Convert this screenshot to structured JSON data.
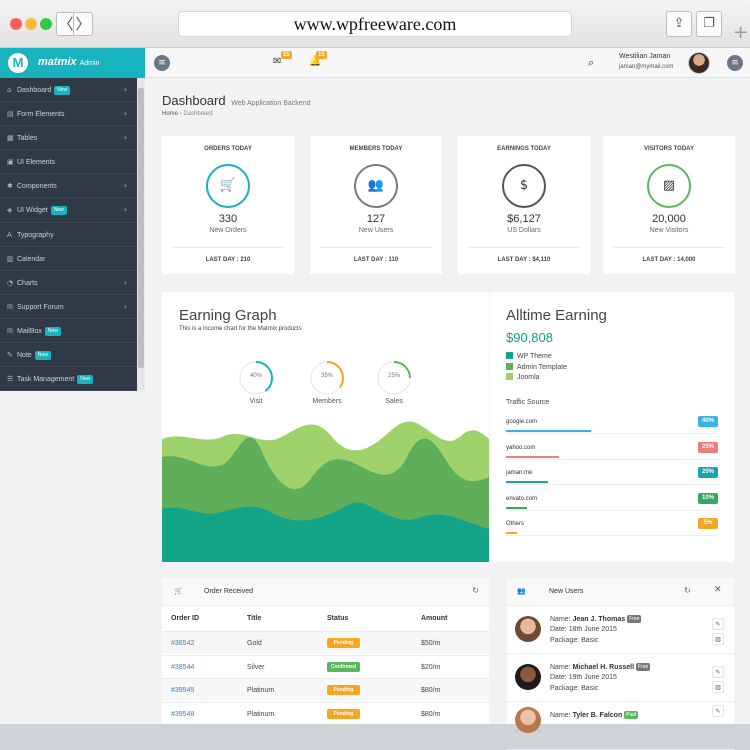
{
  "browser": {
    "url": "www.wpfreeware.com",
    "back_glyph": "〈",
    "forward_glyph": "〉",
    "share_icon": "share-icon",
    "tabs_icon": "tabs-icon",
    "colors": {
      "close": "#fc605c",
      "minimize": "#fdbc40",
      "zoom": "#34c84a"
    }
  },
  "brand": {
    "logo_letter": "M",
    "name": "matmix",
    "suffix": "Admin",
    "color": "#19b3bf"
  },
  "topbar": {
    "messages_count": "15",
    "notifications_count": "15",
    "user_name": "Westilian Jaman",
    "user_email": "jaman@mymail.com"
  },
  "sidebar": {
    "new_label": "New",
    "items": [
      {
        "label": "Dashboard",
        "icon": "⌂",
        "badge": true,
        "chevron": true
      },
      {
        "label": "Form Elements",
        "icon": "▤",
        "badge": false,
        "chevron": true
      },
      {
        "label": "Tables",
        "icon": "▦",
        "badge": false,
        "chevron": true
      },
      {
        "label": "UI Elements",
        "icon": "▣",
        "badge": false,
        "chevron": false
      },
      {
        "label": "Components",
        "icon": "✱",
        "badge": false,
        "chevron": true
      },
      {
        "label": "UI Widget",
        "icon": "◈",
        "badge": true,
        "chevron": true
      },
      {
        "label": "Typography",
        "icon": "A",
        "badge": false,
        "chevron": false
      },
      {
        "label": "Calendar",
        "icon": "▥",
        "badge": false,
        "chevron": false
      },
      {
        "label": "Charts",
        "icon": "◔",
        "badge": false,
        "chevron": true
      },
      {
        "label": "Support Forum",
        "icon": "✉",
        "badge": false,
        "chevron": true
      },
      {
        "label": "MailBox",
        "icon": "✉",
        "badge": true,
        "chevron": false
      },
      {
        "label": "Note",
        "icon": "✎",
        "badge": true,
        "chevron": false
      },
      {
        "label": "Task Management",
        "icon": "☰",
        "badge": true,
        "chevron": false
      }
    ]
  },
  "page": {
    "title": "Dashboard",
    "subtitle": "Web Application Backend",
    "breadcrumb_home": "Home",
    "breadcrumb_sep": "›",
    "breadcrumb_current": "Dashboard"
  },
  "stats": [
    {
      "title": "ORDERS TODAY",
      "value": "330",
      "label": "New Orders",
      "last": "LAST DAY : 210",
      "icon": "🛒",
      "color": "#19b3bf"
    },
    {
      "title": "MEMBERS TODAY",
      "value": "127",
      "label": "New Users",
      "last": "LAST DAY : 110",
      "icon": "👥",
      "color": "#7a7a7a"
    },
    {
      "title": "EARNINGS TODAY",
      "value": "$6,127",
      "label": "US Dollars",
      "last": "LAST DAY : $4,110",
      "icon": "$",
      "color": "#555555"
    },
    {
      "title": "VISITORS TODAY",
      "value": "20,000",
      "label": "New Visitors",
      "last": "LAST DAY : 14,000",
      "icon": "▨",
      "color": "#5cb85c"
    }
  ],
  "earning_graph": {
    "title": "Earning Graph",
    "subtitle": "This is a income chart for the Matmix products",
    "gauges": [
      {
        "label": "Visit",
        "value": "40%",
        "fraction": 0.4,
        "color": "#19b3bf"
      },
      {
        "label": "Members",
        "value": "35%",
        "fraction": 0.35,
        "color": "#f5a623"
      },
      {
        "label": "Sales",
        "value": "25%",
        "fraction": 0.25,
        "color": "#5cb85c"
      }
    ],
    "wave_colors": [
      "#9fd26a",
      "#5fae5a",
      "#13a386"
    ]
  },
  "alltime": {
    "title": "Alltime Earning",
    "value": "$90,808",
    "legend": [
      {
        "label": "WP Theme",
        "color": "#13a386"
      },
      {
        "label": "Admin Template",
        "color": "#5fae5a"
      },
      {
        "label": "Joomla",
        "color": "#9fd26a"
      }
    ],
    "traffic_title": "Traffic Source",
    "traffic": [
      {
        "name": "google.com",
        "pct": "40%",
        "fraction": 0.4,
        "color": "#39b2e6"
      },
      {
        "name": "yahoo.com",
        "pct": "25%",
        "fraction": 0.25,
        "color": "#ef7d79"
      },
      {
        "name": "jaman.me",
        "pct": "20%",
        "fraction": 0.2,
        "color": "#16a5b3"
      },
      {
        "name": "envato.com",
        "pct": "10%",
        "fraction": 0.1,
        "color": "#37a95f"
      },
      {
        "name": "Others",
        "pct": "5%",
        "fraction": 0.05,
        "color": "#f5a623"
      }
    ]
  },
  "orders": {
    "title": "Order Received",
    "columns": [
      "Order ID",
      "Title",
      "Status",
      "Amount"
    ],
    "rows": [
      {
        "id": "#36542",
        "title": "Gold",
        "status": "Pending",
        "status_color": "#f5a623",
        "amount": "$50/m"
      },
      {
        "id": "#38544",
        "title": "Silver",
        "status": "Confirmed",
        "status_color": "#5cb85c",
        "amount": "$20/m"
      },
      {
        "id": "#39545",
        "title": "Platinum",
        "status": "Pending",
        "status_color": "#f5a623",
        "amount": "$80/m"
      },
      {
        "id": "#39548",
        "title": "Platinum",
        "status": "Pending",
        "status_color": "#f5a623",
        "amount": "$80/m"
      }
    ]
  },
  "new_users": {
    "title": "New Users",
    "name_label": "Name:",
    "date_label": "Date:",
    "package_label": "Package:",
    "users": [
      {
        "name": "Jean J. Thomas",
        "badge": "Free",
        "badge_color": "#777777",
        "date": "18th June 2015",
        "package": "Basic"
      },
      {
        "name": "Michael H. Russell",
        "badge": "Free",
        "badge_color": "#777777",
        "date": "19th June 2015",
        "package": "Basic"
      },
      {
        "name": "Tyler B. Falcon",
        "badge": "Paid",
        "badge_color": "#5cb85c",
        "date": "",
        "package": ""
      }
    ]
  }
}
